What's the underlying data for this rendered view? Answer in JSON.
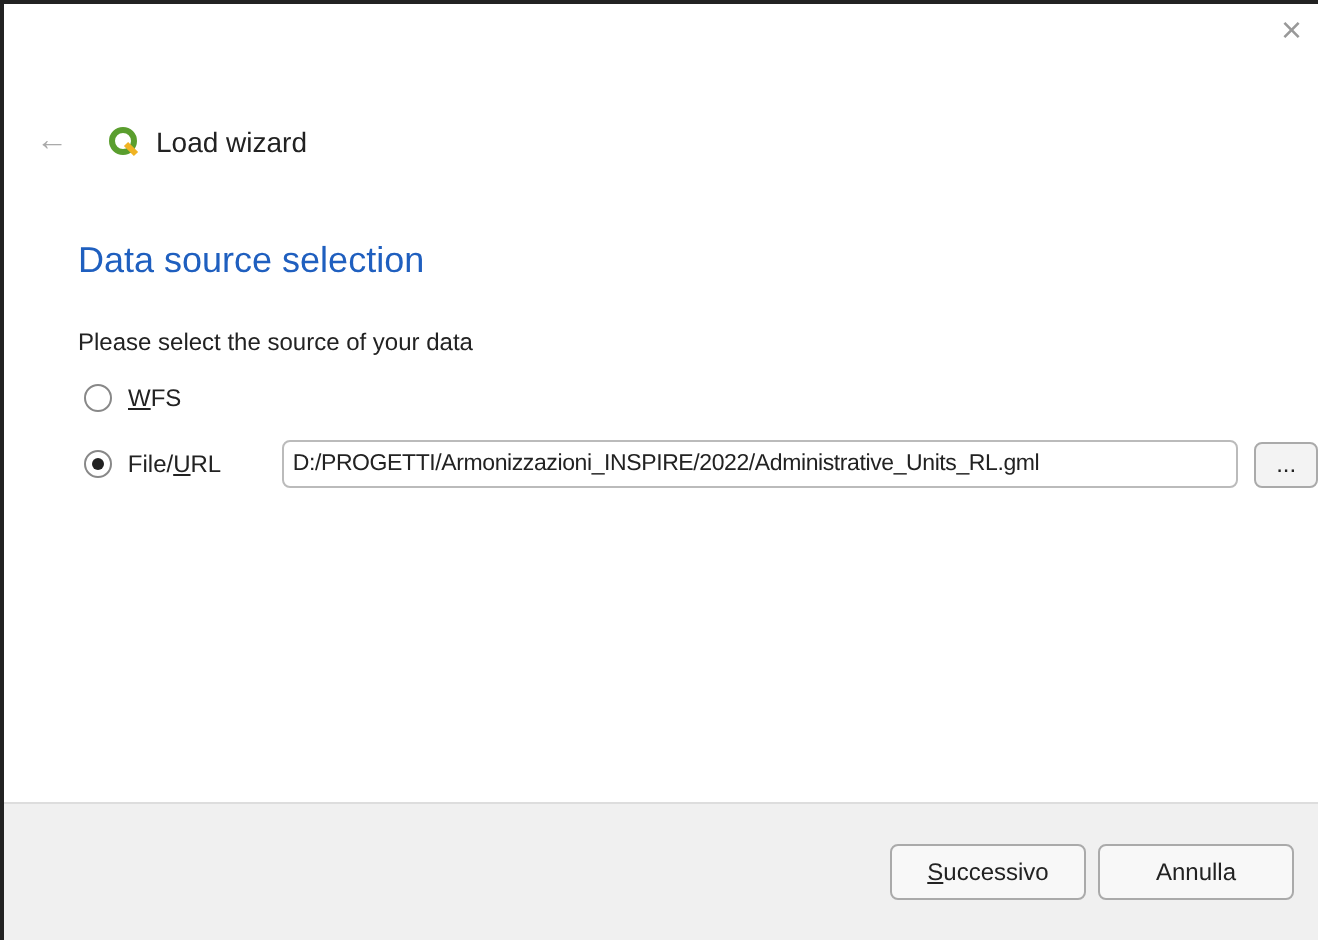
{
  "window": {
    "close_symbol": "×"
  },
  "header": {
    "back_symbol": "←",
    "title": "Load wizard"
  },
  "page": {
    "heading": "Data source selection",
    "prompt": "Please select the source of your data"
  },
  "sources": [
    {
      "label_parts": {
        "key": "W",
        "after": "FS"
      },
      "selected": false
    },
    {
      "label_parts": {
        "before": "File/",
        "key": "U",
        "after": "RL"
      },
      "selected": true,
      "path": "D:/PROGETTI/Armonizzazioni_INSPIRE/2022/Administrative_Units_RL.gml",
      "browse": "..."
    }
  ],
  "buttons": [
    {
      "label_parts": {
        "key": "S",
        "after": "uccessivo"
      }
    },
    {
      "label_parts": {
        "before": "Annulla"
      }
    }
  ]
}
